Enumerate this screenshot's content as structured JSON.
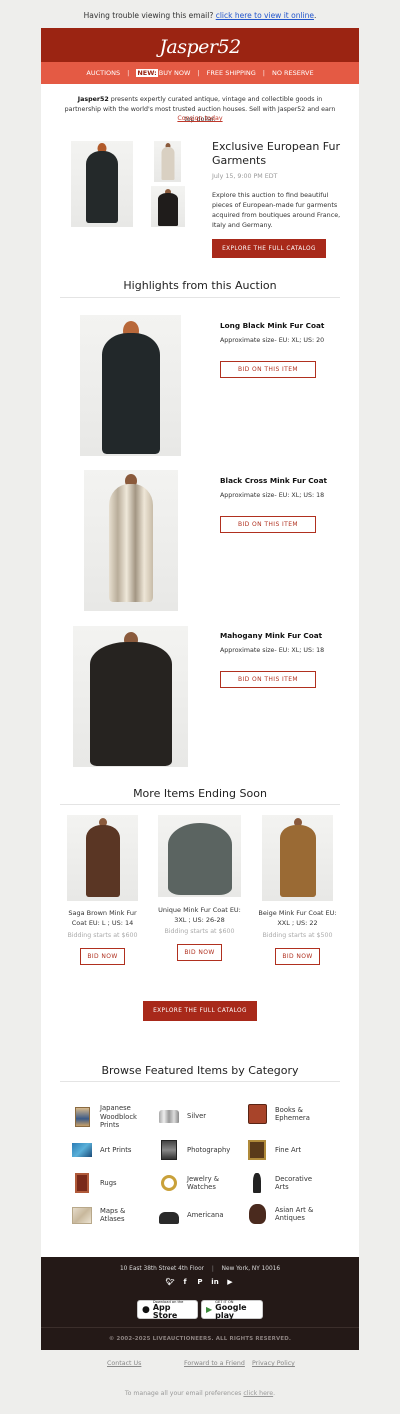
{
  "top_notice": {
    "text": "Having trouble viewing this email?",
    "link": "click here to view it online",
    "end": "."
  },
  "header": {
    "logo": "Jasper52",
    "nav": [
      {
        "label": "AUCTIONS"
      },
      {
        "badge": "NEW:",
        "label": "BUY NOW"
      },
      {
        "label": "FREE SHIPPING"
      },
      {
        "label": "NO RESERVE"
      }
    ],
    "separator": "|"
  },
  "intro": {
    "brand": "Jasper52",
    "text": " presents expertly curated antique, vintage and collectible goods in partnership with the world's most trusted auction houses. Sell with Jasper52 and earn top dollar.",
    "consign_link": "Consign today"
  },
  "hero": {
    "title": "Exclusive European Fur Garments",
    "date": "July 15, 9:00 PM EDT",
    "description": "Explore this auction to find beautiful pieces of European-made fur garments acquired from boutiques around France, Italy and Germany.",
    "cta": "EXPLORE THE FULL CATALOG"
  },
  "highlights": {
    "title": "Highlights from this Auction",
    "items": [
      {
        "name": "Long Black Mink Fur Coat",
        "size": "Approximate size- EU: XL; US: 20",
        "button": "BID ON THIS ITEM"
      },
      {
        "name": "Black Cross Mink Fur Coat",
        "size": "Approximate size- EU: XL; US: 18",
        "button": "BID ON THIS ITEM"
      },
      {
        "name": "Mahogany Mink Fur Coat",
        "size": "Approximate size- EU: XL; US: 18",
        "button": "BID ON THIS ITEM"
      }
    ]
  },
  "ending_soon": {
    "title": "More Items Ending Soon",
    "items": [
      {
        "name": "Saga Brown Mink Fur Coat EU: L ; US: 14",
        "price": "Bidding starts at $600",
        "button": "BID NOW"
      },
      {
        "name": "Unique Mink Fur Coat EU: 3XL ; US: 26-28",
        "price": "Bidding starts at $600",
        "button": "BID NOW"
      },
      {
        "name": "Beige Mink Fur Coat EU: XXL ; US: 22",
        "price": "Bidding starts at $500",
        "button": "BID NOW"
      }
    ],
    "cta": "EXPLORE THE FULL CATALOG"
  },
  "categories": {
    "title": "Browse Featured Items by Category",
    "items": [
      {
        "label": "Japanese Woodblock Prints",
        "icon": "woodblock-print-icon"
      },
      {
        "label": "Silver",
        "icon": "silver-icon"
      },
      {
        "label": "Books & Ephemera",
        "icon": "books-icon"
      },
      {
        "label": "Art Prints",
        "icon": "art-print-icon"
      },
      {
        "label": "Photography",
        "icon": "photography-icon"
      },
      {
        "label": "Fine Art",
        "icon": "fine-art-icon"
      },
      {
        "label": "Rugs",
        "icon": "rug-icon"
      },
      {
        "label": "Jewelry & Watches",
        "icon": "watch-icon"
      },
      {
        "label": "Decorative Arts",
        "icon": "decorative-arts-icon"
      },
      {
        "label": "Maps & Atlases",
        "icon": "map-icon"
      },
      {
        "label": "Americana",
        "icon": "americana-icon"
      },
      {
        "label": "Asian Art & Antiques",
        "icon": "asian-art-icon"
      }
    ]
  },
  "footer": {
    "address": "10 East 38th Street 4th Floor",
    "city": "New York, NY 10016",
    "social": [
      "twitter-icon",
      "facebook-icon",
      "pinterest-icon",
      "linkedin-icon",
      "youtube-icon"
    ],
    "app_store": {
      "small": "Download on the",
      "big": "App Store"
    },
    "google_play": {
      "small": "GET IT ON",
      "big": "Google play"
    },
    "copyright": "© 2002-2025 LIVEAUCTIONEERS. ALL RIGHTS RESERVED."
  },
  "bottom": {
    "contact": "Contact Us",
    "forward": "Forward to a Friend",
    "privacy": "Privacy Policy",
    "manage_text": "To manage all your email preferences ",
    "manage_link": "click here",
    "manage_end": "."
  },
  "colors": {
    "brand_dark": "#9b2412",
    "brand_light": "#e45a44",
    "footer_bg": "#241917",
    "accent": "#a8291a"
  }
}
